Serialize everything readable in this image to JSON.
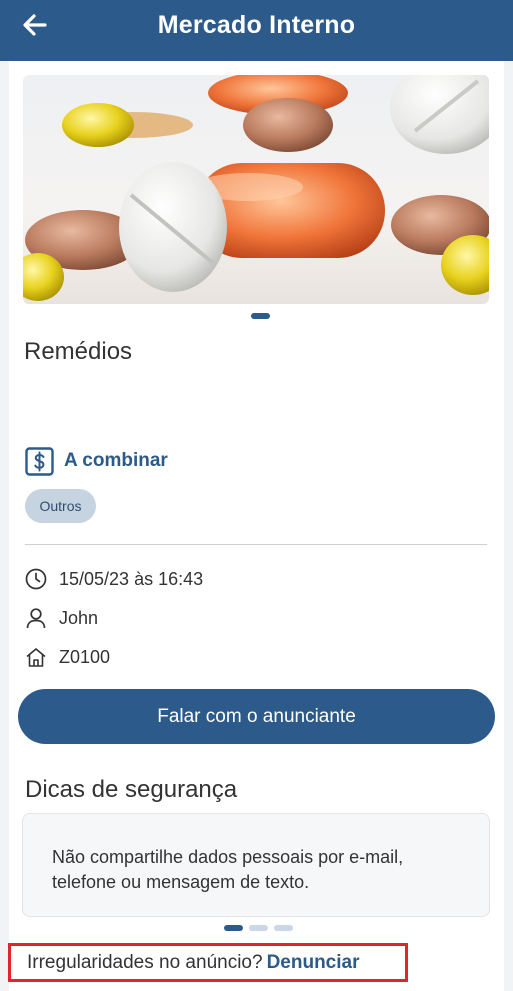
{
  "header": {
    "title": "Mercado Interno",
    "back_icon": "arrow-left-icon"
  },
  "listing": {
    "name": "Remédios",
    "image_subject": "pills",
    "price": "A combinar",
    "price_icon": "dollar-sign-icon",
    "category": "Outros",
    "date": "15/05/23 às 16:43",
    "author": "John",
    "location": "Z0100",
    "contact_label": "Falar com o anunciante"
  },
  "safety": {
    "title": "Dicas de segurança",
    "tip": "Não compartilhe dados pessoais por e-mail, telefone ou mensagem de texto."
  },
  "report": {
    "question": "Irregularidades no anúncio?",
    "link": "Denunciar"
  },
  "colors": {
    "primary": "#2c5a8a",
    "tag_bg": "#c6d3e1",
    "highlight": "#e3252a"
  }
}
